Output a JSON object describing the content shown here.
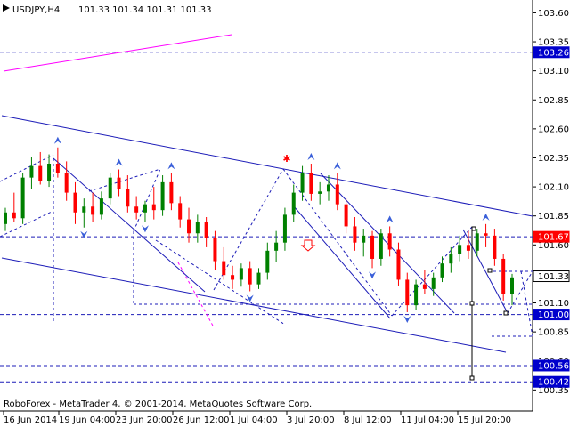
{
  "header": {
    "symbol": "USDJPY,H4",
    "ohlc": "101.33 101.34 101.31 101.33"
  },
  "footer": {
    "copyright": "RoboForex - MetaTrader 4, © 2001-2014, MetaQuotes Software Corp."
  },
  "colors": {
    "bull": "#008000",
    "bear": "#ff0000",
    "channel": "#0000cc",
    "pink": "#ff00ff",
    "fractal": "#3a5fd9",
    "level_badge": "#0000cc",
    "highlight_badge": "#ff0000"
  },
  "chart_data": {
    "type": "candlestick",
    "symbol": "USDJPY",
    "timeframe": "H4",
    "ylim": [
      100.23,
      103.68
    ],
    "y_ticks": [
      "103.60",
      "103.35",
      "103.10",
      "102.85",
      "102.60",
      "102.35",
      "102.10",
      "101.85",
      "101.60",
      "101.35",
      "101.10",
      "100.85",
      "100.60",
      "100.35"
    ],
    "x_ticks": [
      "16 Jun 2014",
      "19 Jun 04:00",
      "23 Jun 20:00",
      "26 Jun 12:00",
      "1 Jul 04:00",
      "3 Jul 20:00",
      "8 Jul 12:00",
      "11 Jul 04:00",
      "15 Jul 20:00"
    ],
    "level_badges": [
      {
        "label": "103.26",
        "value": 103.26,
        "style": "dark"
      },
      {
        "label": "101.67",
        "value": 101.67,
        "style": "red"
      },
      {
        "label": "101.33",
        "value": 101.33,
        "style": "plain"
      },
      {
        "label": "101.00",
        "value": 101.0,
        "style": "dark"
      },
      {
        "label": "100.56",
        "value": 100.56,
        "style": "dark"
      },
      {
        "label": "100.42",
        "value": 100.42,
        "style": "dark"
      }
    ],
    "price_levels": [
      103.26,
      101.67,
      101.0,
      100.56,
      100.42
    ],
    "candles": [
      {
        "i": 0,
        "o": 101.78,
        "h": 101.92,
        "l": 101.72,
        "c": 101.88
      },
      {
        "i": 1,
        "o": 101.88,
        "h": 102.05,
        "l": 101.8,
        "c": 101.83
      },
      {
        "i": 2,
        "o": 101.83,
        "h": 102.22,
        "l": 101.78,
        "c": 102.18
      },
      {
        "i": 3,
        "o": 102.18,
        "h": 102.36,
        "l": 102.08,
        "c": 102.28
      },
      {
        "i": 4,
        "o": 102.28,
        "h": 102.4,
        "l": 102.12,
        "c": 102.15
      },
      {
        "i": 5,
        "o": 102.15,
        "h": 102.38,
        "l": 102.1,
        "c": 102.3
      },
      {
        "i": 6,
        "o": 102.3,
        "h": 102.44,
        "l": 102.18,
        "c": 102.22
      },
      {
        "i": 7,
        "o": 102.22,
        "h": 102.32,
        "l": 101.98,
        "c": 102.05
      },
      {
        "i": 8,
        "o": 102.05,
        "h": 102.14,
        "l": 101.78,
        "c": 101.88
      },
      {
        "i": 9,
        "o": 101.88,
        "h": 102.0,
        "l": 101.75,
        "c": 101.93
      },
      {
        "i": 10,
        "o": 101.93,
        "h": 102.05,
        "l": 101.8,
        "c": 101.86
      },
      {
        "i": 11,
        "o": 101.86,
        "h": 102.06,
        "l": 101.82,
        "c": 102.0
      },
      {
        "i": 12,
        "o": 102.0,
        "h": 102.22,
        "l": 101.95,
        "c": 102.18
      },
      {
        "i": 13,
        "o": 102.18,
        "h": 102.25,
        "l": 102.02,
        "c": 102.08
      },
      {
        "i": 14,
        "o": 102.08,
        "h": 102.2,
        "l": 101.88,
        "c": 101.93
      },
      {
        "i": 15,
        "o": 101.93,
        "h": 102.02,
        "l": 101.82,
        "c": 101.88
      },
      {
        "i": 16,
        "o": 101.88,
        "h": 101.98,
        "l": 101.8,
        "c": 101.95
      },
      {
        "i": 17,
        "o": 101.95,
        "h": 102.1,
        "l": 101.82,
        "c": 101.9
      },
      {
        "i": 18,
        "o": 101.9,
        "h": 102.2,
        "l": 101.85,
        "c": 102.14
      },
      {
        "i": 19,
        "o": 102.14,
        "h": 102.22,
        "l": 101.9,
        "c": 101.96
      },
      {
        "i": 20,
        "o": 101.96,
        "h": 102.02,
        "l": 101.75,
        "c": 101.82
      },
      {
        "i": 21,
        "o": 101.82,
        "h": 101.92,
        "l": 101.62,
        "c": 101.7
      },
      {
        "i": 22,
        "o": 101.7,
        "h": 101.86,
        "l": 101.62,
        "c": 101.8
      },
      {
        "i": 23,
        "o": 101.8,
        "h": 101.84,
        "l": 101.58,
        "c": 101.66
      },
      {
        "i": 24,
        "o": 101.66,
        "h": 101.72,
        "l": 101.38,
        "c": 101.46
      },
      {
        "i": 25,
        "o": 101.46,
        "h": 101.58,
        "l": 101.3,
        "c": 101.34
      },
      {
        "i": 26,
        "o": 101.34,
        "h": 101.42,
        "l": 101.22,
        "c": 101.3
      },
      {
        "i": 27,
        "o": 101.3,
        "h": 101.44,
        "l": 101.24,
        "c": 101.4
      },
      {
        "i": 28,
        "o": 101.4,
        "h": 101.46,
        "l": 101.2,
        "c": 101.26
      },
      {
        "i": 29,
        "o": 101.26,
        "h": 101.4,
        "l": 101.22,
        "c": 101.36
      },
      {
        "i": 30,
        "o": 101.36,
        "h": 101.62,
        "l": 101.3,
        "c": 101.55
      },
      {
        "i": 31,
        "o": 101.55,
        "h": 101.72,
        "l": 101.45,
        "c": 101.62
      },
      {
        "i": 32,
        "o": 101.62,
        "h": 101.92,
        "l": 101.55,
        "c": 101.86
      },
      {
        "i": 33,
        "o": 101.86,
        "h": 102.12,
        "l": 101.8,
        "c": 102.05
      },
      {
        "i": 34,
        "o": 102.05,
        "h": 102.28,
        "l": 101.98,
        "c": 102.22
      },
      {
        "i": 35,
        "o": 102.22,
        "h": 102.3,
        "l": 101.98,
        "c": 102.04
      },
      {
        "i": 36,
        "o": 102.04,
        "h": 102.14,
        "l": 101.95,
        "c": 102.06
      },
      {
        "i": 37,
        "o": 102.06,
        "h": 102.2,
        "l": 101.98,
        "c": 102.12
      },
      {
        "i": 38,
        "o": 102.12,
        "h": 102.22,
        "l": 101.9,
        "c": 101.95
      },
      {
        "i": 39,
        "o": 101.95,
        "h": 102.0,
        "l": 101.7,
        "c": 101.76
      },
      {
        "i": 40,
        "o": 101.76,
        "h": 101.84,
        "l": 101.55,
        "c": 101.62
      },
      {
        "i": 41,
        "o": 101.62,
        "h": 101.74,
        "l": 101.5,
        "c": 101.68
      },
      {
        "i": 42,
        "o": 101.68,
        "h": 101.72,
        "l": 101.4,
        "c": 101.48
      },
      {
        "i": 43,
        "o": 101.48,
        "h": 101.74,
        "l": 101.42,
        "c": 101.7
      },
      {
        "i": 44,
        "o": 101.7,
        "h": 101.76,
        "l": 101.5,
        "c": 101.56
      },
      {
        "i": 45,
        "o": 101.56,
        "h": 101.62,
        "l": 101.25,
        "c": 101.3
      },
      {
        "i": 46,
        "o": 101.3,
        "h": 101.36,
        "l": 101.02,
        "c": 101.08
      },
      {
        "i": 47,
        "o": 101.08,
        "h": 101.3,
        "l": 101.04,
        "c": 101.26
      },
      {
        "i": 48,
        "o": 101.26,
        "h": 101.38,
        "l": 101.18,
        "c": 101.22
      },
      {
        "i": 49,
        "o": 101.22,
        "h": 101.36,
        "l": 101.16,
        "c": 101.32
      },
      {
        "i": 50,
        "o": 101.32,
        "h": 101.5,
        "l": 101.28,
        "c": 101.44
      },
      {
        "i": 51,
        "o": 101.44,
        "h": 101.58,
        "l": 101.36,
        "c": 101.52
      },
      {
        "i": 52,
        "o": 101.52,
        "h": 101.68,
        "l": 101.46,
        "c": 101.6
      },
      {
        "i": 53,
        "o": 101.6,
        "h": 101.72,
        "l": 101.48,
        "c": 101.55
      },
      {
        "i": 54,
        "o": 101.55,
        "h": 101.74,
        "l": 101.5,
        "c": 101.7
      },
      {
        "i": 55,
        "o": 101.7,
        "h": 101.78,
        "l": 101.58,
        "c": 101.68
      },
      {
        "i": 56,
        "o": 101.68,
        "h": 101.74,
        "l": 101.42,
        "c": 101.48
      },
      {
        "i": 57,
        "o": 101.48,
        "h": 101.52,
        "l": 101.12,
        "c": 101.18
      },
      {
        "i": 58,
        "o": 101.18,
        "h": 101.35,
        "l": 101.08,
        "c": 101.32
      }
    ]
  }
}
